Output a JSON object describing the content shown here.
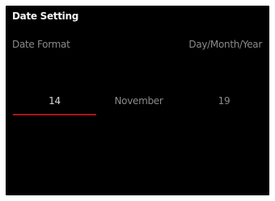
{
  "title": "Date Setting",
  "date_format": {
    "label": "Date Format",
    "value": "Day/Month/Year"
  },
  "picker": {
    "day": "14",
    "month": "November",
    "year": "19",
    "selected": "day"
  },
  "colors": {
    "background": "#000000",
    "text_primary": "#f2f2f2",
    "text_secondary": "#8a8a8a",
    "accent": "#a8161c"
  }
}
